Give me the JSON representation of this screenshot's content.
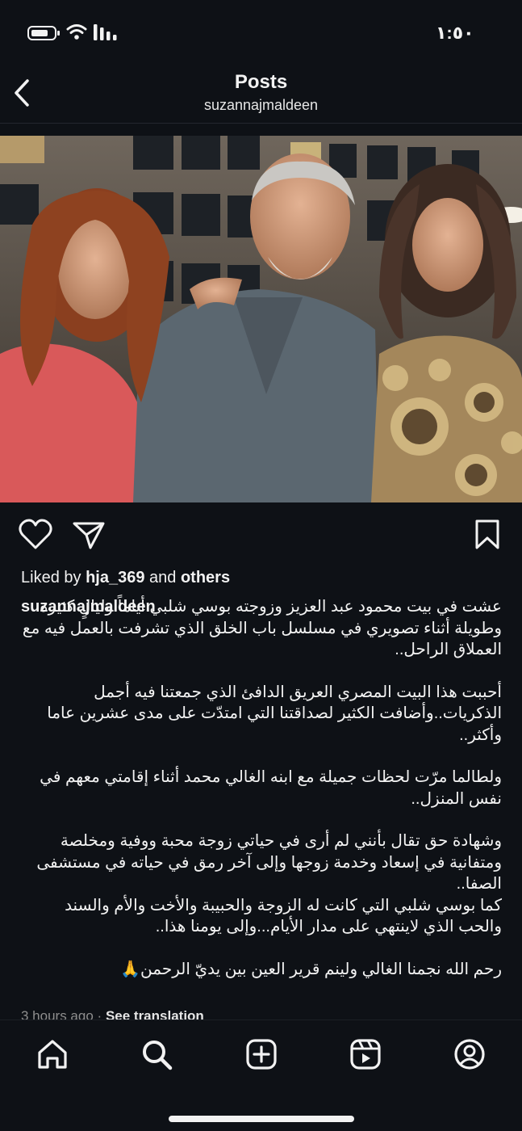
{
  "status_bar": {
    "time": "١:٥٠"
  },
  "header": {
    "title": "Posts",
    "username": "suzannajmaldeen"
  },
  "photo": {
    "description_icon": "post-photo"
  },
  "likes": {
    "prefix": "Liked by",
    "user": "hja_369",
    "middle": "and",
    "suffix": "others"
  },
  "caption": {
    "username": "suzannajmaldeen",
    "paragraphs": [
      "عشت في بيت محمود عبد العزيز وزوجته بوسي شلبي أياماً وليالٍ كثيرة وطويلة أثناء تصويري في مسلسل باب الخلق الذي تشرفت بالعمل فيه مع العملاق الراحل..",
      "أحببت هذا البيت المصري العريق الدافئ الذي جمعتنا فيه أجمل الذكريات..وأضافت الكثير لصداقتنا التي امتدّت على مدى عشرين عاما وأكثر..",
      "ولطالما مرّت لحظات جميلة مع ابنه الغالي محمد أثناء إقامتي معهم في نفس المنزل..",
      "وشهادة حق تقال بأنني لم أرى في حياتي زوجة محبة ووفية ومخلصة ومتفانية في إسعاد وخدمة زوجها وإلى آخر رمق في حياته في مستشفى الصفا..",
      "كما بوسي شلبي التي كانت له الزوجة والحبيبة والأخت والأم والسند والحب الذي لاينتهي على مدار الأيام...وإلى يومنا هذا..",
      "رحم الله نجمنا الغالي ولينم قرير العين بين يديّ الرحمن🙏"
    ]
  },
  "meta": {
    "time_ago": "3 hours ago",
    "separator": "·",
    "translation": "See translation"
  },
  "colors": {
    "background": "#0e1116",
    "text": "#f2f2f2",
    "muted": "#8e8e8e"
  }
}
